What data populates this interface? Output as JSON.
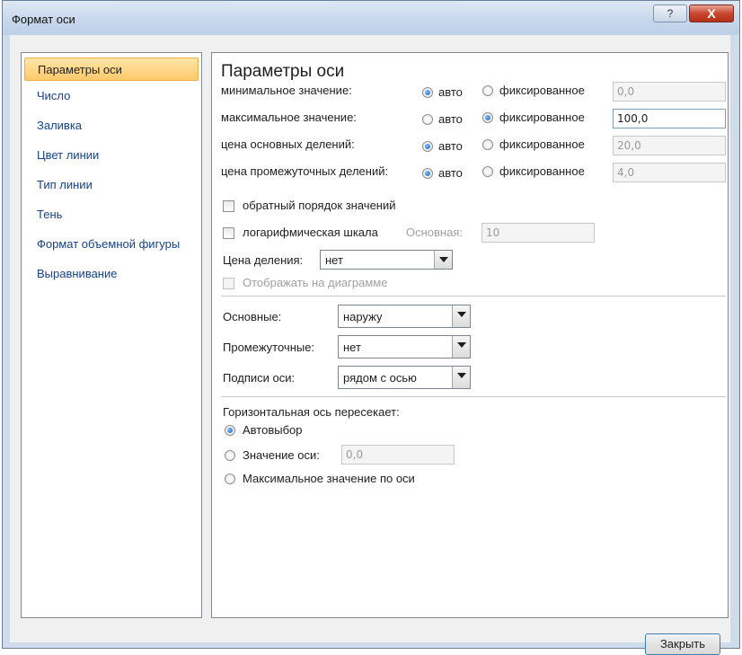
{
  "top_caption": "",
  "window": {
    "title": "Формат оси",
    "help_button": "?",
    "close_button": "X"
  },
  "nav": {
    "items": [
      {
        "label": "Параметры оси",
        "selected": true
      },
      {
        "label": "Число"
      },
      {
        "label": "Заливка"
      },
      {
        "label": "Цвет линии"
      },
      {
        "label": "Тип линии"
      },
      {
        "label": "Тень"
      },
      {
        "label": "Формат объемной фигуры"
      },
      {
        "label": "Выравнивание"
      }
    ]
  },
  "axis_options": {
    "heading": "Параметры оси",
    "rows": [
      {
        "label": "минимальное значение:",
        "selected": "auto",
        "value": "0,0"
      },
      {
        "label": "максимальное значение:",
        "selected": "fixed",
        "value": "100,0"
      },
      {
        "label": "цена основных делений:",
        "selected": "auto",
        "value": "20,0"
      },
      {
        "label": "цена промежуточных делений:",
        "selected": "auto",
        "value": "4,0"
      }
    ],
    "auto_label": "авто",
    "fixed_label": "фиксированное",
    "reverse_order": {
      "label": "обратный порядок значений",
      "checked": false
    },
    "log_scale": {
      "label": "логарифмическая шкала",
      "checked": false,
      "base_label": "Основная:",
      "base_value": "10"
    },
    "display_units": {
      "label": "Цена деления:",
      "value": "нет"
    },
    "show_on_chart": {
      "label": "Отображать на диаграмме",
      "checked": false,
      "enabled": false
    }
  },
  "tick_marks": {
    "major": {
      "label": "Основные:",
      "value": "наружу"
    },
    "minor": {
      "label": "Промежуточные:",
      "value": "нет"
    },
    "axis_labels": {
      "label": "Подписи оси:",
      "value": "рядом с осью"
    }
  },
  "horizontal_axis_crosses": {
    "heading": "Горизонтальная ось пересекает:",
    "options": [
      {
        "label": "Автовыбор",
        "selected": true
      },
      {
        "label": "Значение оси:",
        "selected": false,
        "value": "0,0"
      },
      {
        "label": "Максимальное значение по оси",
        "selected": false
      }
    ]
  },
  "buttons": {
    "close": "Закрыть"
  }
}
